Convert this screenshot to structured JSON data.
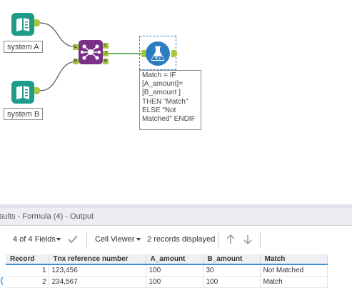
{
  "canvas": {
    "input_a": {
      "label": "system A",
      "icon": "book-icon"
    },
    "input_b": {
      "label": "system B",
      "icon": "book-icon"
    },
    "join": {
      "icon": "join-icon",
      "ports_in": [
        "L",
        "R"
      ],
      "ports_out": [
        "L",
        "J",
        "R"
      ]
    },
    "formula": {
      "icon": "flask-icon",
      "annotation": [
        "Match = IF",
        "[A_amount]=",
        "[B_amount ]",
        "THEN \"Match\"",
        "ELSE \"Not",
        "Matched\" ENDIF"
      ]
    }
  },
  "results": {
    "title": "sults - Formula (4) - Output",
    "toolbar": {
      "fields": "4 of 4 Fields",
      "viewer": "Cell Viewer",
      "records": "2 records displayed"
    },
    "columns": [
      "Record",
      "Tnx reference number",
      "A_amount",
      "B_amount",
      "Match"
    ],
    "rows": [
      [
        "1",
        "123,456",
        "100",
        "30",
        "Not Matched"
      ],
      [
        "2",
        "234,567",
        "100",
        "100",
        "Match"
      ]
    ]
  },
  "colors": {
    "input_tool": "#1f9b8a",
    "join_tool": "#7b2f86",
    "formula_tool": "#2c7cc0",
    "anchor": "#a6c93b",
    "header_accent": "#3a8fd8"
  }
}
